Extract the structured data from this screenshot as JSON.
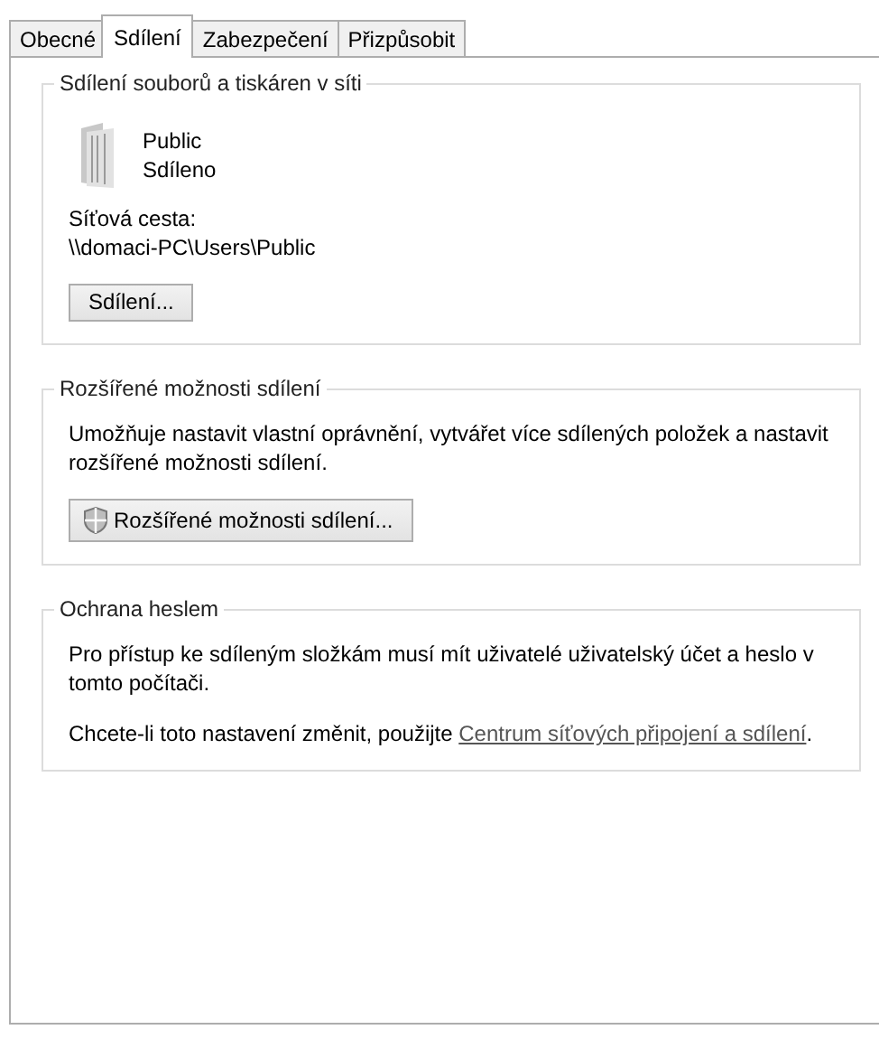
{
  "tabs": [
    {
      "label": "Obecné",
      "selected": false
    },
    {
      "label": "Sdílení",
      "selected": true
    },
    {
      "label": "Zabezpečení",
      "selected": false
    },
    {
      "label": "Přizpůsobit",
      "selected": false
    }
  ],
  "groups": [
    {
      "kind": "share",
      "title": "Sdílení souborů a tiskáren v síti",
      "item_name": "Public",
      "item_status": "Sdíleno",
      "path_label": "Síťová cesta:",
      "path": "\\\\domaci-PC\\Users\\Public",
      "button": "Sdílení..."
    },
    {
      "kind": "advanced",
      "title": "Rozšířené možnosti sdílení",
      "description": "Umožňuje nastavit vlastní oprávnění, vytvářet více sdílených položek a nastavit rozšířené možnosti sdílení.",
      "button": "Rozšířené možnosti sdílení..."
    },
    {
      "kind": "password",
      "title": "Ochrana heslem",
      "description": "Pro přístup ke sdíleným složkám musí mít uživatelé uživatelský účet a heslo v tomto počítači.",
      "note": "Chcete-li toto nastavení změnit, použijte",
      "link": "Centrum síťových připojení a sdílení",
      "note_end": "."
    }
  ]
}
